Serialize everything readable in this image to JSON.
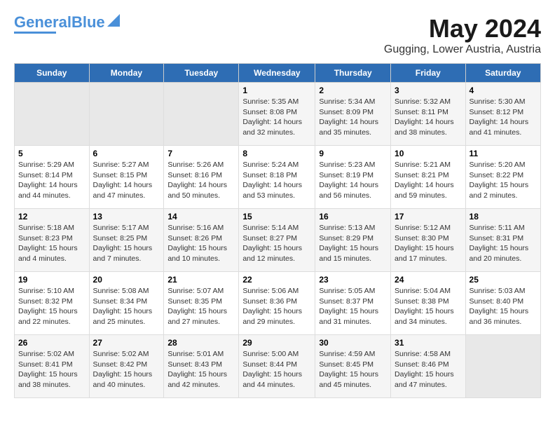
{
  "header": {
    "logo_general": "General",
    "logo_blue": "Blue",
    "main_title": "May 2024",
    "subtitle": "Gugging, Lower Austria, Austria"
  },
  "calendar": {
    "weekdays": [
      "Sunday",
      "Monday",
      "Tuesday",
      "Wednesday",
      "Thursday",
      "Friday",
      "Saturday"
    ],
    "weeks": [
      [
        {
          "day": "",
          "info": ""
        },
        {
          "day": "",
          "info": ""
        },
        {
          "day": "",
          "info": ""
        },
        {
          "day": "1",
          "info": "Sunrise: 5:35 AM\nSunset: 8:08 PM\nDaylight: 14 hours\nand 32 minutes."
        },
        {
          "day": "2",
          "info": "Sunrise: 5:34 AM\nSunset: 8:09 PM\nDaylight: 14 hours\nand 35 minutes."
        },
        {
          "day": "3",
          "info": "Sunrise: 5:32 AM\nSunset: 8:11 PM\nDaylight: 14 hours\nand 38 minutes."
        },
        {
          "day": "4",
          "info": "Sunrise: 5:30 AM\nSunset: 8:12 PM\nDaylight: 14 hours\nand 41 minutes."
        }
      ],
      [
        {
          "day": "5",
          "info": "Sunrise: 5:29 AM\nSunset: 8:14 PM\nDaylight: 14 hours\nand 44 minutes."
        },
        {
          "day": "6",
          "info": "Sunrise: 5:27 AM\nSunset: 8:15 PM\nDaylight: 14 hours\nand 47 minutes."
        },
        {
          "day": "7",
          "info": "Sunrise: 5:26 AM\nSunset: 8:16 PM\nDaylight: 14 hours\nand 50 minutes."
        },
        {
          "day": "8",
          "info": "Sunrise: 5:24 AM\nSunset: 8:18 PM\nDaylight: 14 hours\nand 53 minutes."
        },
        {
          "day": "9",
          "info": "Sunrise: 5:23 AM\nSunset: 8:19 PM\nDaylight: 14 hours\nand 56 minutes."
        },
        {
          "day": "10",
          "info": "Sunrise: 5:21 AM\nSunset: 8:21 PM\nDaylight: 14 hours\nand 59 minutes."
        },
        {
          "day": "11",
          "info": "Sunrise: 5:20 AM\nSunset: 8:22 PM\nDaylight: 15 hours\nand 2 minutes."
        }
      ],
      [
        {
          "day": "12",
          "info": "Sunrise: 5:18 AM\nSunset: 8:23 PM\nDaylight: 15 hours\nand 4 minutes."
        },
        {
          "day": "13",
          "info": "Sunrise: 5:17 AM\nSunset: 8:25 PM\nDaylight: 15 hours\nand 7 minutes."
        },
        {
          "day": "14",
          "info": "Sunrise: 5:16 AM\nSunset: 8:26 PM\nDaylight: 15 hours\nand 10 minutes."
        },
        {
          "day": "15",
          "info": "Sunrise: 5:14 AM\nSunset: 8:27 PM\nDaylight: 15 hours\nand 12 minutes."
        },
        {
          "day": "16",
          "info": "Sunrise: 5:13 AM\nSunset: 8:29 PM\nDaylight: 15 hours\nand 15 minutes."
        },
        {
          "day": "17",
          "info": "Sunrise: 5:12 AM\nSunset: 8:30 PM\nDaylight: 15 hours\nand 17 minutes."
        },
        {
          "day": "18",
          "info": "Sunrise: 5:11 AM\nSunset: 8:31 PM\nDaylight: 15 hours\nand 20 minutes."
        }
      ],
      [
        {
          "day": "19",
          "info": "Sunrise: 5:10 AM\nSunset: 8:32 PM\nDaylight: 15 hours\nand 22 minutes."
        },
        {
          "day": "20",
          "info": "Sunrise: 5:08 AM\nSunset: 8:34 PM\nDaylight: 15 hours\nand 25 minutes."
        },
        {
          "day": "21",
          "info": "Sunrise: 5:07 AM\nSunset: 8:35 PM\nDaylight: 15 hours\nand 27 minutes."
        },
        {
          "day": "22",
          "info": "Sunrise: 5:06 AM\nSunset: 8:36 PM\nDaylight: 15 hours\nand 29 minutes."
        },
        {
          "day": "23",
          "info": "Sunrise: 5:05 AM\nSunset: 8:37 PM\nDaylight: 15 hours\nand 31 minutes."
        },
        {
          "day": "24",
          "info": "Sunrise: 5:04 AM\nSunset: 8:38 PM\nDaylight: 15 hours\nand 34 minutes."
        },
        {
          "day": "25",
          "info": "Sunrise: 5:03 AM\nSunset: 8:40 PM\nDaylight: 15 hours\nand 36 minutes."
        }
      ],
      [
        {
          "day": "26",
          "info": "Sunrise: 5:02 AM\nSunset: 8:41 PM\nDaylight: 15 hours\nand 38 minutes."
        },
        {
          "day": "27",
          "info": "Sunrise: 5:02 AM\nSunset: 8:42 PM\nDaylight: 15 hours\nand 40 minutes."
        },
        {
          "day": "28",
          "info": "Sunrise: 5:01 AM\nSunset: 8:43 PM\nDaylight: 15 hours\nand 42 minutes."
        },
        {
          "day": "29",
          "info": "Sunrise: 5:00 AM\nSunset: 8:44 PM\nDaylight: 15 hours\nand 44 minutes."
        },
        {
          "day": "30",
          "info": "Sunrise: 4:59 AM\nSunset: 8:45 PM\nDaylight: 15 hours\nand 45 minutes."
        },
        {
          "day": "31",
          "info": "Sunrise: 4:58 AM\nSunset: 8:46 PM\nDaylight: 15 hours\nand 47 minutes."
        },
        {
          "day": "",
          "info": ""
        }
      ]
    ]
  }
}
